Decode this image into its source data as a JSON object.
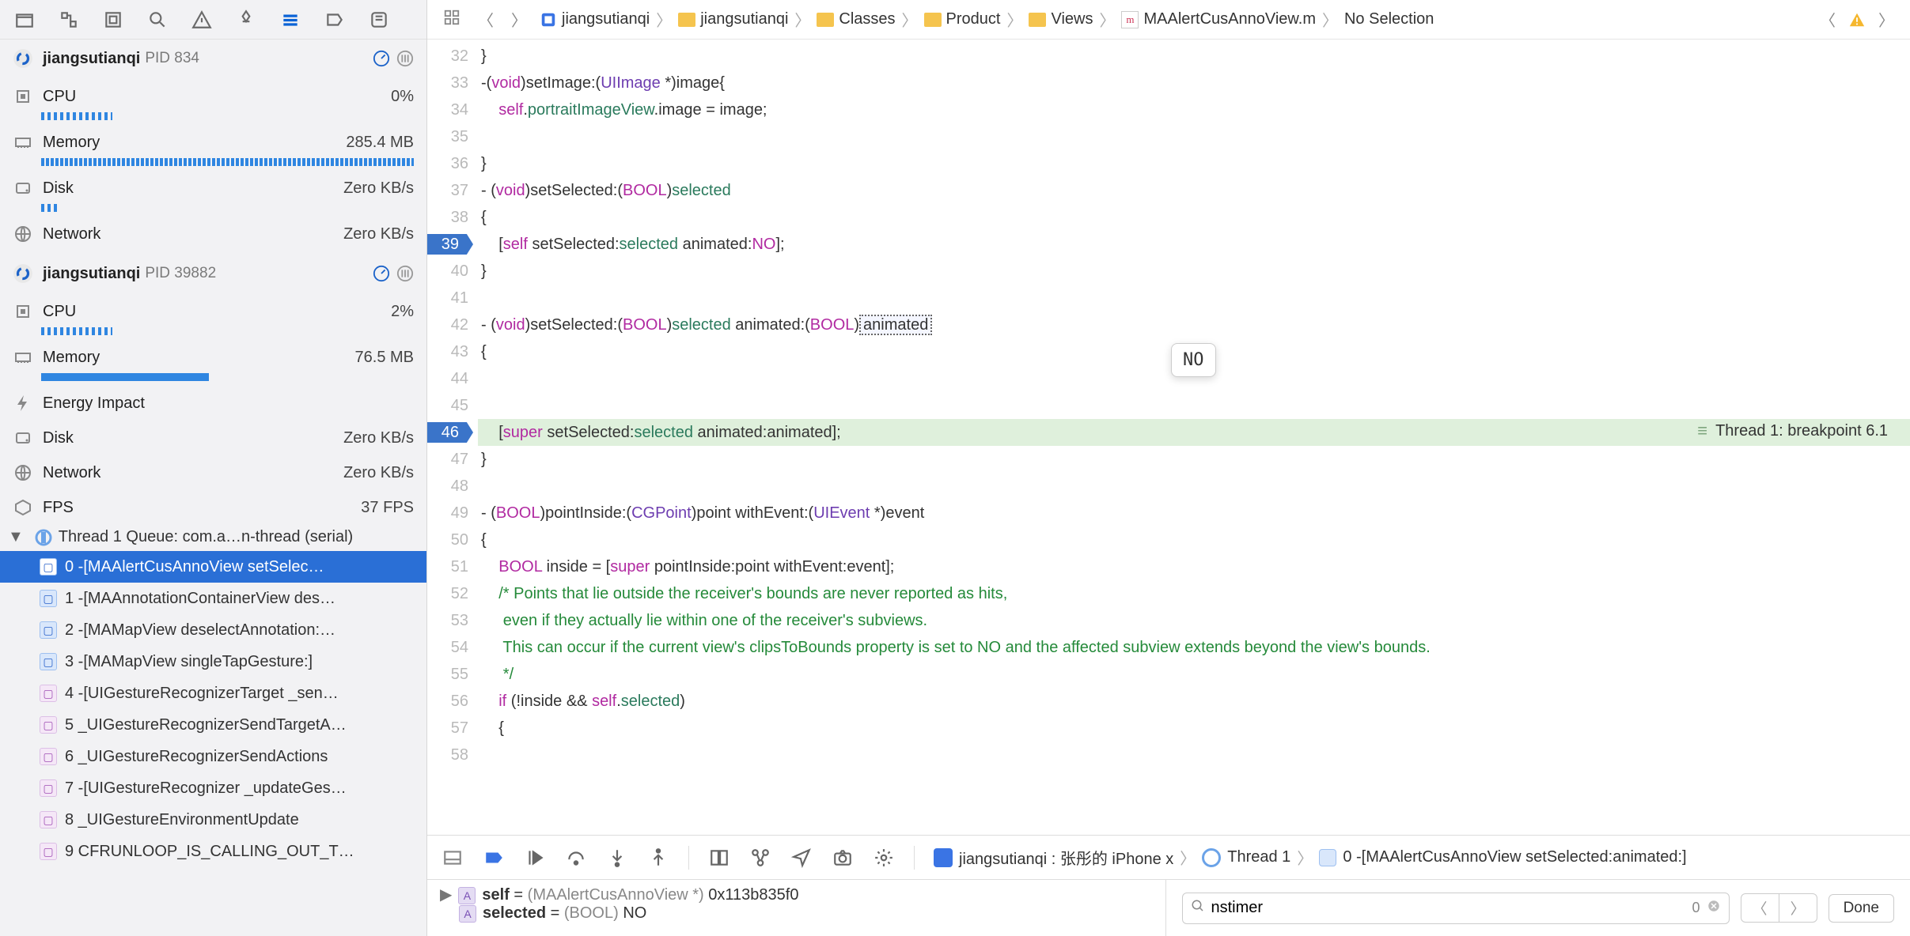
{
  "sidebar": {
    "procs": [
      {
        "name": "jiangsutianqi",
        "pid": "PID 834",
        "metrics": [
          {
            "label": "CPU",
            "value": "0%"
          },
          {
            "label": "Memory",
            "value": "285.4 MB"
          },
          {
            "label": "Disk",
            "value": "Zero KB/s"
          },
          {
            "label": "Network",
            "value": "Zero KB/s"
          }
        ]
      },
      {
        "name": "jiangsutianqi",
        "pid": "PID 39882",
        "metrics": [
          {
            "label": "CPU",
            "value": "2%"
          },
          {
            "label": "Memory",
            "value": "76.5 MB"
          },
          {
            "label": "Energy Impact",
            "value": ""
          },
          {
            "label": "Disk",
            "value": "Zero KB/s"
          },
          {
            "label": "Network",
            "value": "Zero KB/s"
          },
          {
            "label": "FPS",
            "value": "37 FPS"
          }
        ]
      }
    ],
    "thread_header": "Thread 1  Queue: com.a…n-thread (serial)",
    "stack": [
      {
        "n": "0",
        "t": "0 -[MAAlertCusAnnoView setSelec…",
        "u": true,
        "sel": true
      },
      {
        "n": "1",
        "t": "1 -[MAAnnotationContainerView des…",
        "u": true
      },
      {
        "n": "2",
        "t": "2 -[MAMapView deselectAnnotation:…",
        "u": true
      },
      {
        "n": "3",
        "t": "3 -[MAMapView singleTapGesture:]",
        "u": true
      },
      {
        "n": "4",
        "t": "4 -[UIGestureRecognizerTarget _sen…"
      },
      {
        "n": "5",
        "t": "5 _UIGestureRecognizerSendTargetA…"
      },
      {
        "n": "6",
        "t": "6 _UIGestureRecognizerSendActions"
      },
      {
        "n": "7",
        "t": "7 -[UIGestureRecognizer _updateGes…"
      },
      {
        "n": "8",
        "t": "8 _UIGestureEnvironmentUpdate"
      },
      {
        "n": "9",
        "t": "9   CFRUNLOOP_IS_CALLING_OUT_T…"
      }
    ]
  },
  "jumpbar": {
    "crumbs": [
      "jiangsutianqi",
      "jiangsutianqi",
      "Classes",
      "Product",
      "Views"
    ],
    "file": "MAAlertCusAnnoView.m",
    "tail": "No Selection"
  },
  "code": {
    "start": 32,
    "breakpoints": [
      39,
      46
    ],
    "highlight": 46,
    "thread_text": "Thread 1: breakpoint 6.1",
    "tooltip": "NO",
    "lines": [
      "}",
      "-(void)setImage:(UIImage *)image{",
      "    self.portraitImageView.image = image;",
      "",
      "}",
      "- (void)setSelected:(BOOL)selected",
      "{",
      "    [self setSelected:selected animated:NO];",
      "}",
      "",
      "- (void)setSelected:(BOOL)selected animated:(BOOL)animated",
      "{",
      "",
      "",
      "    [super setSelected:selected animated:animated];",
      "}",
      "",
      "- (BOOL)pointInside:(CGPoint)point withEvent:(UIEvent *)event",
      "{",
      "    BOOL inside = [super pointInside:point withEvent:event];",
      "    /* Points that lie outside the receiver's bounds are never reported as hits,",
      "     even if they actually lie within one of the receiver's subviews.",
      "     This can occur if the current view's clipsToBounds property is set to NO and the affected subview extends beyond the view's bounds.",
      "     */",
      "    if (!inside && self.selected)",
      "    {",
      ""
    ]
  },
  "debugbar": {
    "process": "jiangsutianqi : 张彤的 iPhone x",
    "thread": "Thread 1",
    "frame": "0 -[MAAlertCusAnnoView setSelected:animated:]"
  },
  "vars": {
    "line1_name": "self",
    "line1_eq": " = ",
    "line1_type": "(MAAlertCusAnnoView *) ",
    "line1_val": "0x113b835f0",
    "line2_name": "selected",
    "line2_eq": " = ",
    "line2_type": "(BOOL) ",
    "line2_val": "NO"
  },
  "console": {
    "search": "nstimer",
    "count": "0",
    "done": "Done"
  }
}
